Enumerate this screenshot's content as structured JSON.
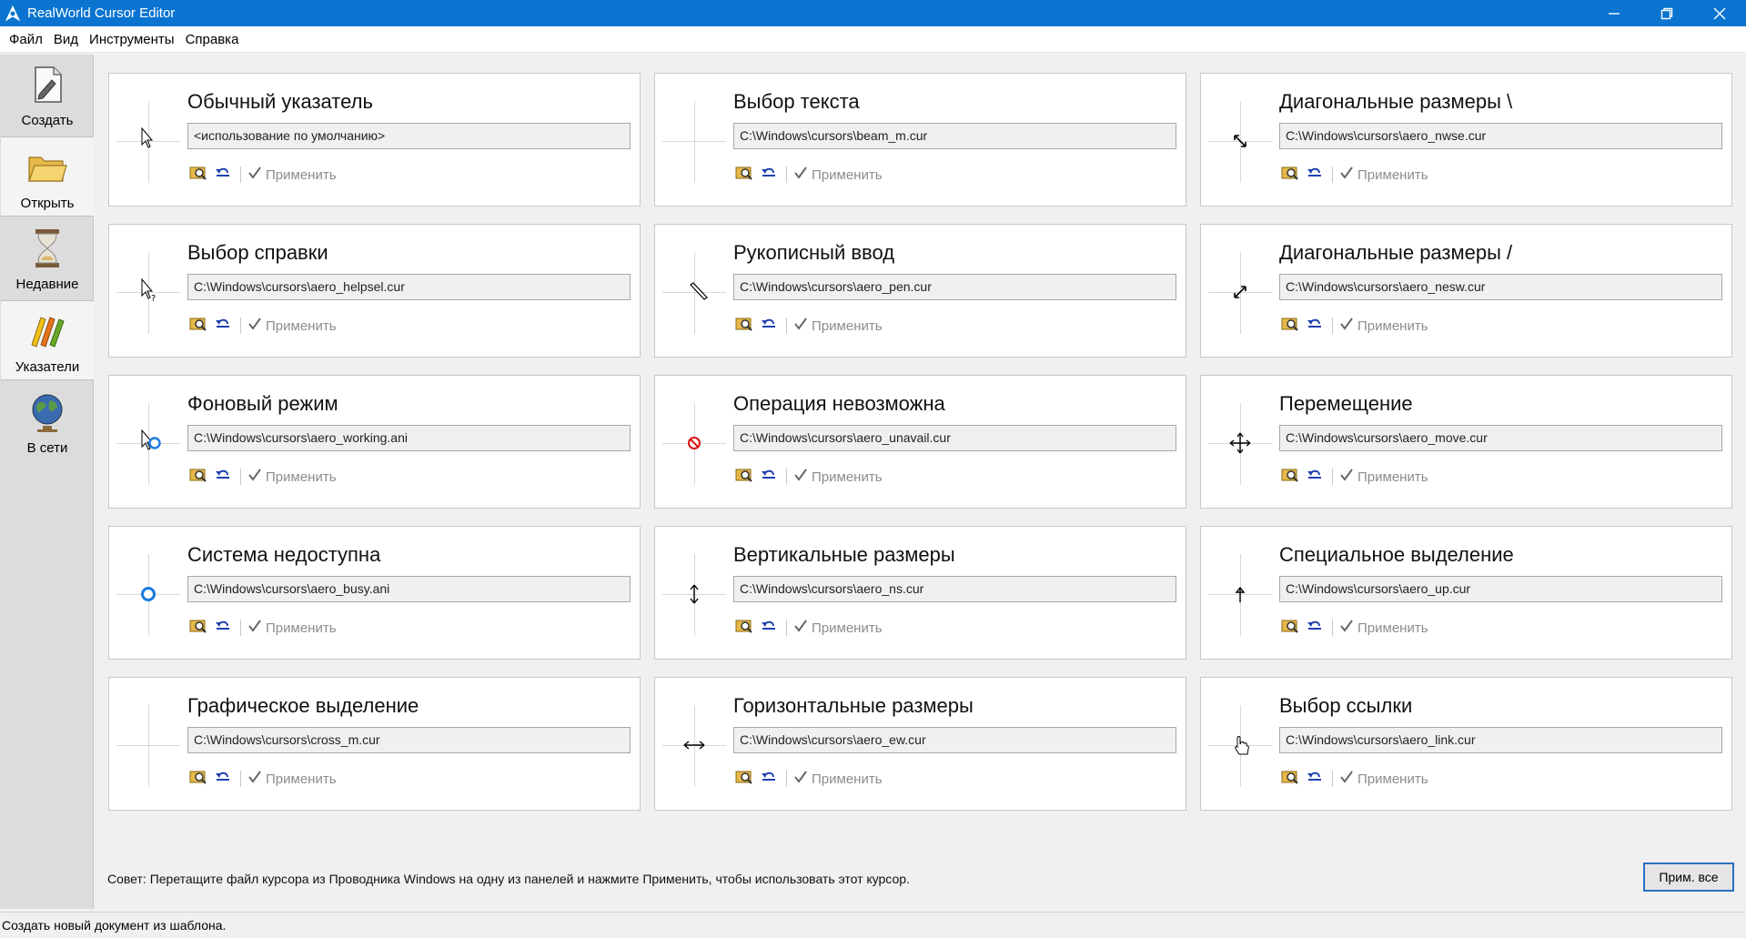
{
  "window": {
    "title": "RealWorld Cursor Editor"
  },
  "menu": [
    "Файл",
    "Вид",
    "Инструменты",
    "Справка"
  ],
  "sidebar": [
    {
      "label": "Создать",
      "icon": "new-document-icon",
      "selected": false
    },
    {
      "label": "Открыть",
      "icon": "open-folder-icon",
      "selected": true
    },
    {
      "label": "Недавние",
      "icon": "hourglass-icon",
      "selected": false
    },
    {
      "label": "Указатели",
      "icon": "pencils-icon",
      "selected": true
    },
    {
      "label": "В сети",
      "icon": "globe-icon",
      "selected": false
    }
  ],
  "apply_label": "Применить",
  "cards": [
    {
      "title": "Обычный указатель",
      "path": "<использование по умолчанию>",
      "cursor": "arrow-icon"
    },
    {
      "title": "Выбор текста",
      "path": "C:\\Windows\\cursors\\beam_m.cur",
      "cursor": "ibeam-icon"
    },
    {
      "title": "Диагональные размеры \\",
      "path": "C:\\Windows\\cursors\\aero_nwse.cur",
      "cursor": "resize-nwse-icon"
    },
    {
      "title": "Выбор справки",
      "path": "C:\\Windows\\cursors\\aero_helpsel.cur",
      "cursor": "help-select-icon"
    },
    {
      "title": "Рукописный ввод",
      "path": "C:\\Windows\\cursors\\aero_pen.cur",
      "cursor": "pen-icon"
    },
    {
      "title": "Диагональные размеры /",
      "path": "C:\\Windows\\cursors\\aero_nesw.cur",
      "cursor": "resize-nesw-icon"
    },
    {
      "title": "Фоновый режим",
      "path": "C:\\Windows\\cursors\\aero_working.ani",
      "cursor": "working-icon"
    },
    {
      "title": "Операция невозможна",
      "path": "C:\\Windows\\cursors\\aero_unavail.cur",
      "cursor": "unavailable-icon"
    },
    {
      "title": "Перемещение",
      "path": "C:\\Windows\\cursors\\aero_move.cur",
      "cursor": "move-icon"
    },
    {
      "title": "Система недоступна",
      "path": "C:\\Windows\\cursors\\aero_busy.ani",
      "cursor": "busy-icon"
    },
    {
      "title": "Вертикальные размеры",
      "path": "C:\\Windows\\cursors\\aero_ns.cur",
      "cursor": "resize-ns-icon"
    },
    {
      "title": "Специальное выделение",
      "path": "C:\\Windows\\cursors\\aero_up.cur",
      "cursor": "up-arrow-icon"
    },
    {
      "title": "Графическое выделение",
      "path": "C:\\Windows\\cursors\\cross_m.cur",
      "cursor": "crosshair-icon"
    },
    {
      "title": "Горизонтальные размеры",
      "path": "C:\\Windows\\cursors\\aero_ew.cur",
      "cursor": "resize-ew-icon"
    },
    {
      "title": "Выбор ссылки",
      "path": "C:\\Windows\\cursors\\aero_link.cur",
      "cursor": "hand-link-icon"
    }
  ],
  "tip": "Совет: Перетащите файл курсора из Проводника Windows на одну из панелей и нажмите Применить, чтобы использовать этот курсор.",
  "apply_all_label": "Прим. все",
  "status": "Создать новый документ из шаблона.",
  "colors": {
    "titlebar": "#0a74d0",
    "accent_border": "#2a6fc4",
    "busy_blue": "#1a7de0",
    "unavailable_red": "#d11"
  }
}
